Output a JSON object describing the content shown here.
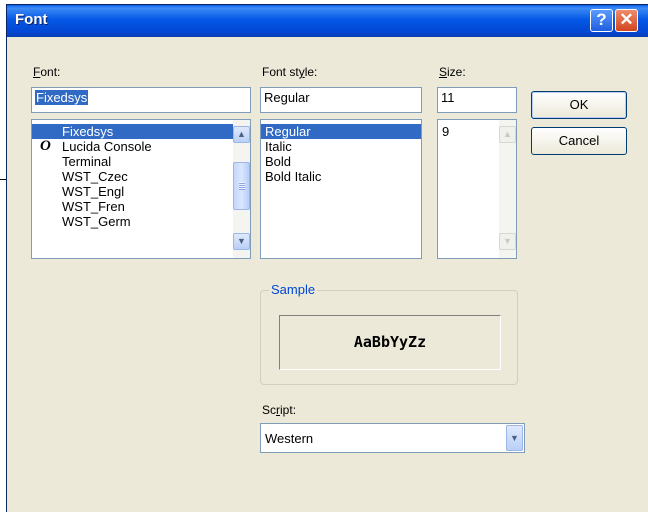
{
  "dialog": {
    "title": "Font"
  },
  "font": {
    "label": "Font:",
    "value": "Fixedsys",
    "items": [
      {
        "label": "Fixedsys",
        "truetype": false
      },
      {
        "label": "Lucida Console",
        "truetype": true
      },
      {
        "label": "Terminal",
        "truetype": false
      },
      {
        "label": "WST_Czec",
        "truetype": false
      },
      {
        "label": "WST_Engl",
        "truetype": false
      },
      {
        "label": "WST_Fren",
        "truetype": false
      },
      {
        "label": "WST_Germ",
        "truetype": false
      }
    ],
    "selected": "Fixedsys"
  },
  "style": {
    "label": "Font style:",
    "value": "Regular",
    "items": [
      "Regular",
      "Italic",
      "Bold",
      "Bold Italic"
    ],
    "selected": "Regular"
  },
  "size": {
    "label": "Size:",
    "value": "11",
    "items": [
      "9"
    ]
  },
  "buttons": {
    "ok": "OK",
    "cancel": "Cancel"
  },
  "sample": {
    "label": "Sample",
    "text": "AaBbYyZz"
  },
  "script": {
    "label": "Script:",
    "value": "Western"
  },
  "colors": {
    "titlebar": "#0558e6",
    "selection": "#316ac5",
    "dialog_bg": "#ece9d8",
    "group_title": "#0046d5"
  },
  "icons": {
    "help": "help-icon",
    "close": "close-icon",
    "truetype": "truetype-font-icon"
  }
}
